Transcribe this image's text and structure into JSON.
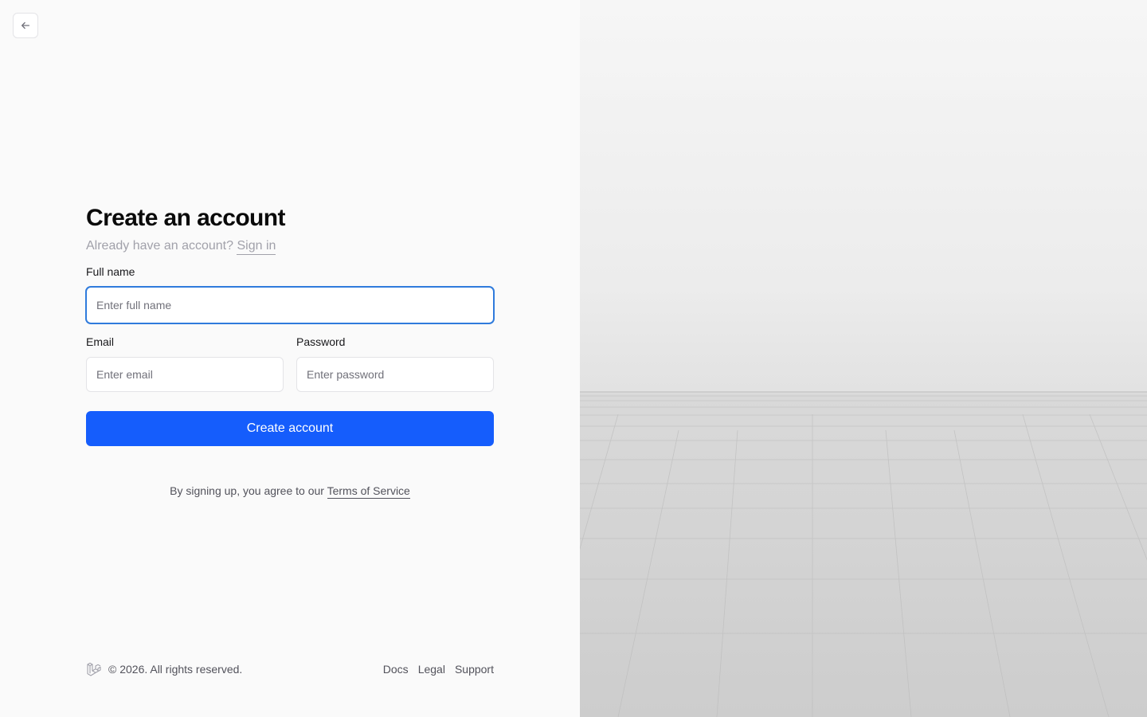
{
  "form": {
    "title": "Create an account",
    "subtitle_prefix": "Already have an account?",
    "signin_link": "Sign in",
    "fullname": {
      "label": "Full name",
      "placeholder": "Enter full name"
    },
    "email": {
      "label": "Email",
      "placeholder": "Enter email"
    },
    "password": {
      "label": "Password",
      "placeholder": "Enter password"
    },
    "submit_label": "Create account",
    "terms_prefix": "By signing up, you agree to our",
    "terms_link": "Terms of Service"
  },
  "footer": {
    "copyright": "© 2026. All rights reserved.",
    "links": [
      "Docs",
      "Legal",
      "Support"
    ]
  },
  "icons": {
    "back": "arrow-left-icon",
    "logo": "laravel-logo-icon"
  },
  "colors": {
    "primary": "#155dfc",
    "focus_ring": "#2f7bdc"
  }
}
